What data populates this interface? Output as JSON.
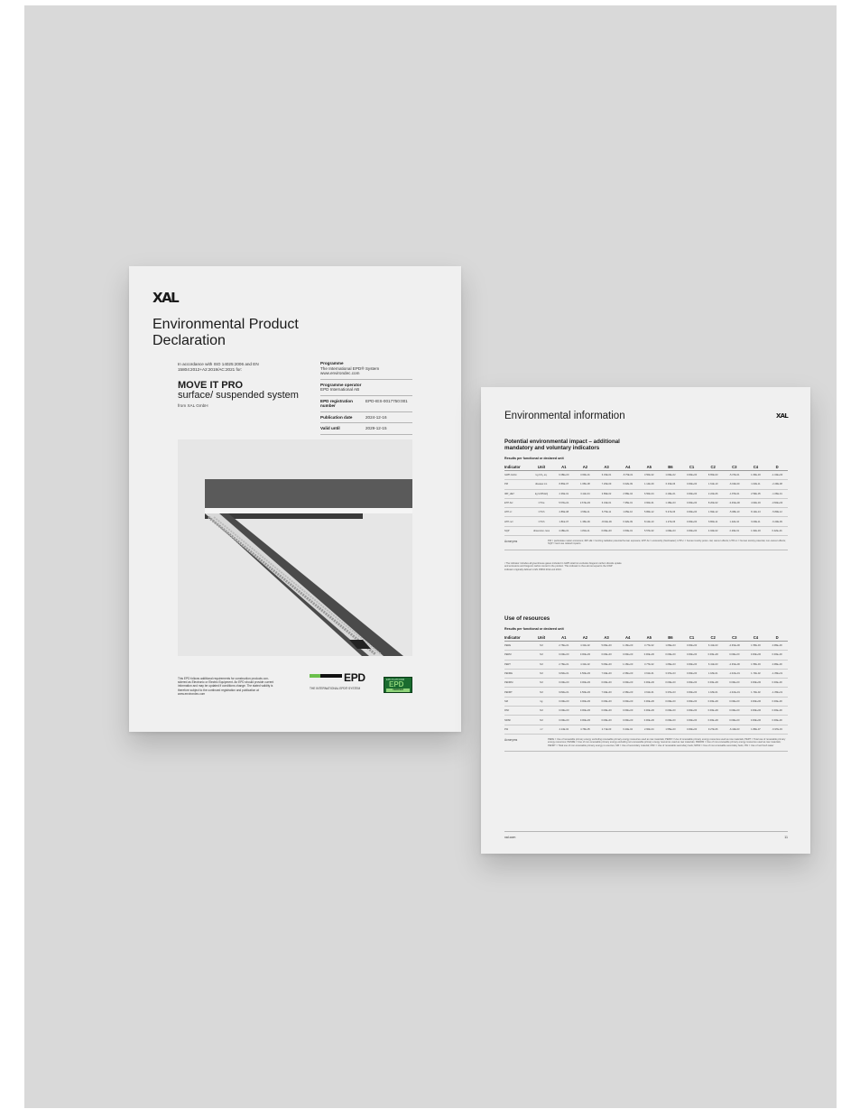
{
  "cover": {
    "logo": "XAL",
    "title": "Environmental Product Declaration",
    "accordance": "In accordance with ISO 14025:2006 and EN 15804:2012+A2:2019/AC:2021 for:",
    "product_name": "MOVE IT PRO",
    "product_desc": "surface/ suspended system",
    "manufacturer": "from XAL GmbH",
    "programme_label": "Programme",
    "programme_value": "The International EPD® System www.environdec.com",
    "operator_label": "Programme operator",
    "operator_value": "EPD International AB",
    "registration_label": "EPD registration number",
    "registration_value": "EPD-IES-0017750:001",
    "publication_label": "Publication date",
    "publication_value": "2024-12-16",
    "valid_label": "Valid until",
    "valid_value": "2029-12-15",
    "footer_note": "This EPD follows additional requirements for construction products con- sidered as Electronic or Electric Equipment. An EPD should provide current information and may be updated if conditions change. The stated validity is therefore subject to the continued registration and publication at www.environdec.com",
    "epd_logo_text": "EPD",
    "epd_logo_sub": "THE INTERNATIONAL EPD® SYSTEM",
    "verified_top": "EPD PLATFORM",
    "verified_mid": "EPD",
    "verified_bot": "VERIFIED"
  },
  "info": {
    "title": "Environmental information",
    "logo": "XAL",
    "impact": {
      "title": "Potential environmental impact – additional mandatory and voluntary indicators",
      "subtitle": "Results per functional or declared unit",
      "columns": [
        "Indicator",
        "Unit",
        "A1",
        "A2",
        "A3",
        "A4",
        "A5",
        "B6",
        "C1",
        "C2",
        "C3",
        "C4",
        "D"
      ],
      "rows": [
        [
          "GWP-GHG¹",
          "kg CO₂ eq.",
          "6.38E+00",
          "3.60E-01",
          "6.33E-01",
          "-5.75E-01",
          "3.50E-02",
          "1.60E+02",
          "0.00E+00",
          "8.65E-03",
          "-5.37E-01",
          "1.66E-03",
          "-1.34E+00"
        ],
        [
          "PM",
          "disease inc.",
          "8.86E-07",
          "1.65E-08",
          "7.26E-09",
          "6.02E-09",
          "1.14E-09",
          "6.33E-06",
          "0.00E+00",
          "1.61E-10",
          "-6.04E-09",
          "1.02E-11",
          "-2.29E-08"
        ],
        [
          "IRP_HE²³",
          "kg U235-EQ",
          "2.36E-01",
          "3.11E-04",
          "3.89E-02",
          "2.58E-04",
          "6.50E-04",
          "4.10E+01",
          "0.00E+00",
          "2.22E-06",
          "-1.87E-01",
          "2.59E-05",
          "-1.66E-01"
        ],
        [
          "ETP-fw²",
          "CTUe",
          "5.57E+01",
          "2.67E+00",
          "6.34E-01",
          "7.35E-01",
          "3.60E-01",
          "1.18E+03",
          "0.00E+00",
          "8.20E-02",
          "-3.46E+00",
          "4.94E-03",
          "-3.60E+00"
        ],
        [
          "HTP-c²",
          "CTUh",
          "2.86E-08",
          "4.56E-11",
          "6.75E-11",
          "1.05E-10",
          "5.86E-12",
          "5.47E-06",
          "0.00E+00",
          "1.69E-12",
          "-5.08E-10",
          "8.12E-13",
          "-5.80E-12"
        ],
        [
          "HTP-nc²",
          "CTUh",
          "1.81E-07",
          "1.35E-09",
          "-8.61E-09",
          "6.32E-09",
          "8.12E-10",
          "1.27E-06",
          "0.00E+00",
          "6.80E-11",
          "1.42E-10",
          "6.09E-11",
          "-6.20E-09"
        ],
        [
          "SQP",
          "dimension- less",
          "4.48E+01",
          "1.81E-11",
          "6.06E+00",
          "3.50E-01",
          "5.57E-02",
          "1.09E+03",
          "0.00E+00",
          "4.94E-02",
          "2.29E-01",
          "1.92E-03",
          "6.42E+01"
        ]
      ],
      "acronyms_label": "Acronyms",
      "acronyms": "PM = particulate matter emissions; IRP-HE = Ionizing radiation potential human exposure; ETP-fw = ecotoxicity (freshwater); HTP-c = human toxicity poten- tial, cancer effects; HTP-nc = human toxicity potential, non-cancer effects; SQP = land use related impacts",
      "footnote": "¹ The indicator includes all greenhouse gases included in GWP-total but excludes biogenic carbon dioxide uptake and emissions and biogenic carbon stored in the product. This indicator is thus almost equal to the GWP indicator originally defined in EN 15804:2012+A1:2013."
    },
    "resources": {
      "title": "Use of resources",
      "subtitle": "Results per functional or declared unit",
      "columns": [
        "Indicator",
        "Unit",
        "A1",
        "A2",
        "A3",
        "A4",
        "A5",
        "B6",
        "C1",
        "C2",
        "C3",
        "C4",
        "D"
      ],
      "rows": [
        [
          "PERE",
          "MJ",
          "2.76E+01",
          "4.31E-02",
          "5.06E+00",
          "1.15E+00",
          "3.77E-02",
          "1.66E+03",
          "0.00E+00",
          "6.41E-03",
          "-2.36E+00",
          "1.55E-03",
          "4.08E+00"
        ],
        [
          "PERM",
          "MJ",
          "0.00E+00",
          "0.00E+00",
          "0.00E+00",
          "0.00E+00",
          "0.00E+00",
          "0.00E+00",
          "0.00E+00",
          "0.00E+00",
          "0.00E+00",
          "0.00E+00",
          "0.00E+00"
        ],
        [
          "PERT",
          "MJ",
          "2.76E+01",
          "4.31E-02",
          "5.06E+00",
          "1.15E+00",
          "3.77E-02",
          "1.66E+03",
          "0.00E+00",
          "6.41E-03",
          "-2.36E+00",
          "1.55E-03",
          "4.08E+00"
        ],
        [
          "PENRE",
          "MJ",
          "9.82E+01",
          "4.56E+00",
          "7.34E+00",
          "2.35E+00",
          "3.61E-01",
          "3.37E+03",
          "0.00E+00",
          "1.18E-01",
          "-1.02E+01",
          "1.74E-02",
          "-1.35E+01"
        ],
        [
          "PENRM",
          "MJ",
          "0.00E+00",
          "0.00E+00",
          "0.00E+00",
          "0.00E+00",
          "0.00E+00",
          "0.00E+00",
          "0.00E+00",
          "0.00E+00",
          "0.00E+00",
          "0.00E+00",
          "0.00E+00"
        ],
        [
          "PENRT",
          "MJ",
          "9.82E+01",
          "4.56E+00",
          "7.34E+00",
          "2.35E+00",
          "3.61E-01",
          "3.37E+03",
          "0.00E+00",
          "1.18E-01",
          "-1.02E+01",
          "1.74E-02",
          "-1.35E+01"
        ],
        [
          "SM",
          "kg",
          "0.00E+00",
          "0.00E+00",
          "0.00E+00",
          "0.00E+00",
          "0.00E+00",
          "0.00E+00",
          "0.00E+00",
          "0.00E+00",
          "0.00E+00",
          "0.00E+00",
          "0.00E+00"
        ],
        [
          "RSF",
          "MJ",
          "0.00E+00",
          "0.00E+00",
          "0.00E+00",
          "0.00E+00",
          "0.00E+00",
          "0.00E+00",
          "0.00E+00",
          "0.00E+00",
          "0.00E+00",
          "0.00E+00",
          "0.00E+00"
        ],
        [
          "NRSF",
          "MJ",
          "0.00E+00",
          "0.00E+00",
          "0.00E+00",
          "0.00E+00",
          "0.00E+00",
          "0.00E+00",
          "0.00E+00",
          "0.00E+00",
          "0.00E+00",
          "0.00E+00",
          "0.00E+00"
        ],
        [
          "FW",
          "m³",
          "4.14E-02",
          "4.76E-05",
          "2.71E-03",
          "6.24E-04",
          "2.60E-04",
          "1.55E+00",
          "0.00E+00",
          "9.27E-06",
          "-6.44E-03",
          "1.86E-07",
          "-6.97E-03"
        ]
      ],
      "acronyms_label": "Acronyms",
      "acronyms": "PERE = Use of renewable primary energy excluding renewable primary energy resources used as raw materials; PERM = Use of renewable primary energy resources used as raw materials; PERT = Total use of renewable primary energy resources; PENRE = Use of non-renewable primary energy excluding non-renewable primary energy resources used as raw materials; PENRM = Use of non-renewable primary energy resources used as raw materials; PENRT = Total use of non-renewable primary energy re-sources; SM = Use of secondary material; RSF = Use of renewable secondary fuels; NRSF = Use of non-renewable secondary fuels; FW = Use of net fresh water"
    },
    "footer_url": "xal.com",
    "page_number": "11"
  }
}
